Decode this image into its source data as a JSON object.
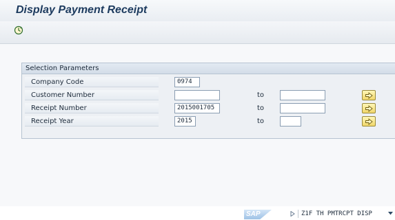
{
  "header": {
    "title": "Display Payment Receipt"
  },
  "toolbar": {
    "execute_icon": "execute-clock-icon"
  },
  "selection": {
    "title": "Selection Parameters",
    "to_label": "to",
    "rows": [
      {
        "label": "Company Code",
        "low": "0974"
      },
      {
        "label": "Customer Number",
        "low": "",
        "high": ""
      },
      {
        "label": "Receipt Number",
        "low": "2015001705",
        "high": ""
      },
      {
        "label": "Receipt Year",
        "low": "2015",
        "high": ""
      }
    ]
  },
  "statusbar": {
    "logo": "SAP",
    "system": "Z1F TH PMTRCPT DISP"
  },
  "colors": {
    "title": "#1c3a5e",
    "group_border": "#b6c3d1",
    "multi_button": "#f0d66a"
  }
}
